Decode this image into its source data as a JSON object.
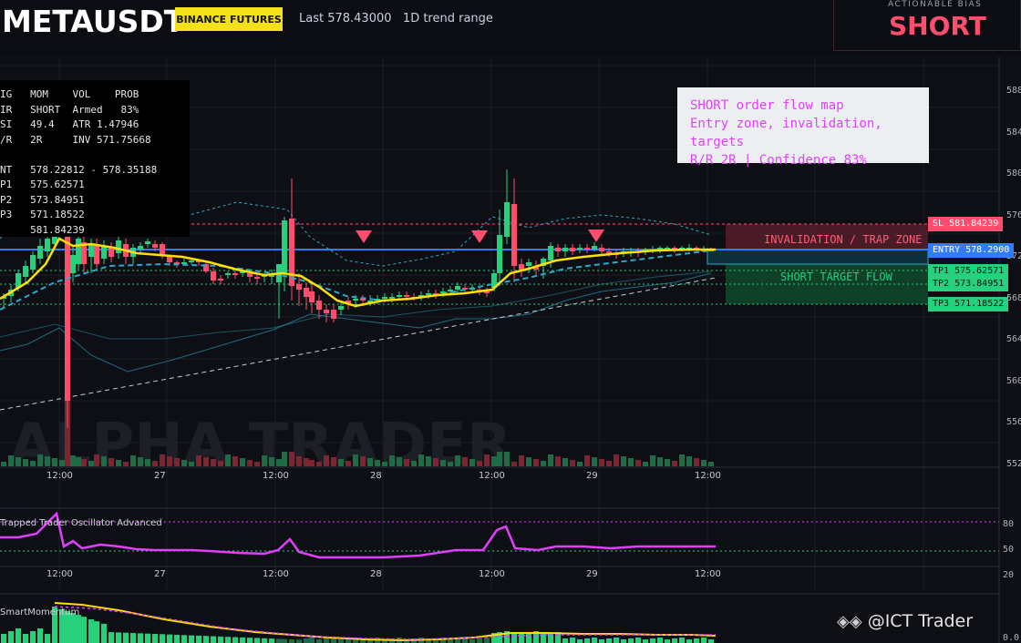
{
  "header": {
    "symbol": "METAUSDT",
    "exchange_badge": "BINANCE FUTURES",
    "last_price": "Last 578.43000",
    "range": "1D trend range"
  },
  "bias": {
    "label": "ACTIONABLE BIAS",
    "value": "SHORT"
  },
  "stats_table": [
    "IG   MOM    VOL    PROB",
    "IR   SHORT  Armed   83%",
    "SI   49.4   ATR 1.47946",
    "/R   2R     INV 571.75668",
    "",
    "NT   578.22812 - 578.35188",
    "P1   575.62571",
    "P2   573.84951",
    "P3   571.18522",
    "     581.84239"
  ],
  "info_panel": {
    "line1": "SHORT order flow map",
    "line2": "Entry zone, invalidation, targets",
    "line3": "R/R 2R | Confidence 83%"
  },
  "zones": {
    "invalidation": "INVALIDATION / TRAP ZONE",
    "target": "SHORT TARGET FLOW"
  },
  "price_labels": {
    "sl": "SL 581.84239",
    "entry": "ENTRY 578.2900",
    "tp1": "TP1 575.62571",
    "tp2": "TP2 573.84951",
    "tp3": "TP3 571.18522"
  },
  "price_axis": [
    "588",
    "584",
    "580",
    "576",
    "572",
    "568",
    "564",
    "560",
    "556",
    "552"
  ],
  "time_axis": [
    "12:00",
    "27",
    "12:00",
    "28",
    "12:00",
    "29",
    "12:00"
  ],
  "watermark": "ALPHA TRADER",
  "oscillator": {
    "title": "Trapped Trader Oscillator Advanced",
    "levels": [
      "80",
      "50",
      "20"
    ]
  },
  "momentum": {
    "title": "SmartMomentum",
    "level": "0.0"
  },
  "attribution": "@ICT Trader",
  "colors": {
    "bull": "#26d07c",
    "bear": "#ff4d6d",
    "entry": "#2f7dff",
    "ma": "#ffe000",
    "osc": "#e040fb",
    "badge": "#f5e11a"
  }
}
